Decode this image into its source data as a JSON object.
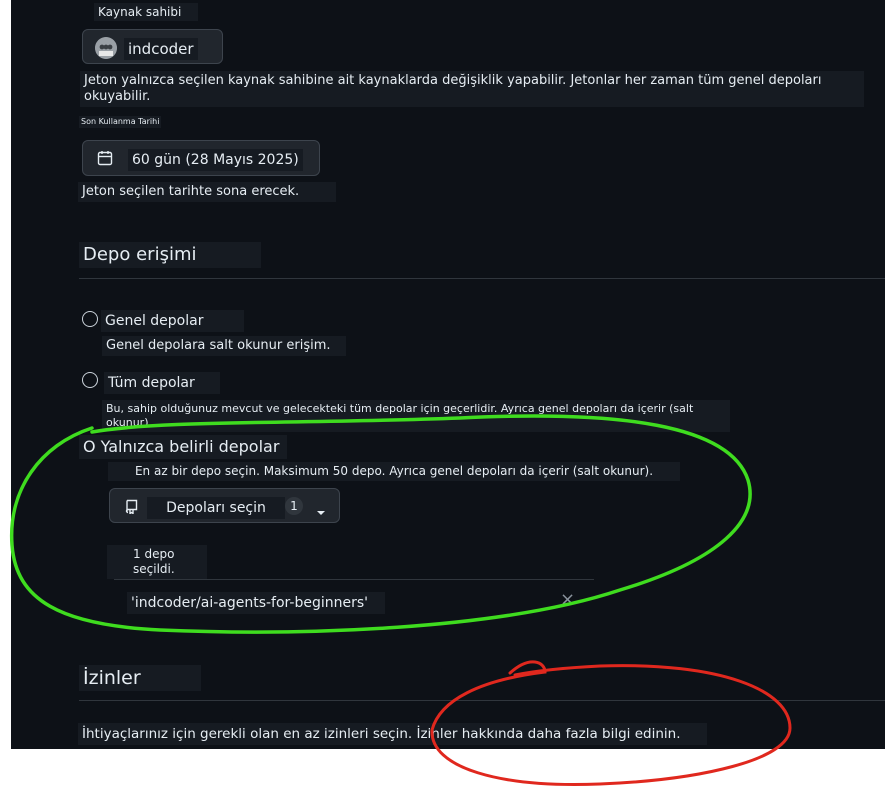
{
  "owner": {
    "label": "Kaynak sahibi",
    "selected": "indcoder",
    "help": "Jeton yalnızca seçilen kaynak sahibine ait kaynaklarda değişiklik yapabilir. Jetonlar her zaman tüm genel depoları okuyabilir."
  },
  "expiration": {
    "label": "Son Kullanma Tarihi",
    "selected": "60 gün (28 Mayıs 2025)",
    "help": "Jeton seçilen tarihte sona erecek."
  },
  "repo_access": {
    "heading": "Depo erişimi",
    "options": [
      {
        "label": "Genel depolar",
        "description": "Genel depolara salt okunur erişim."
      },
      {
        "label": "Tüm depolar",
        "description": "Bu, sahip olduğunuz mevcut ve gelecekteki tüm depolar için geçerlidir. Ayrıca genel depoları da içerir (salt okunur)."
      },
      {
        "label": "O Yalnızca belirli depolar",
        "description": "En az bir depo seçin. Maksimum 50 depo. Ayrıca genel depoları da içerir (salt okunur)."
      }
    ],
    "select_button": "Depoları seçin",
    "select_count": "1",
    "selected_summary": "1 depo seçildi.",
    "selected_repo": "'indcoder/ai-agents-for-beginners'",
    "remove_symbol": "×"
  },
  "permissions": {
    "heading": "İzinler",
    "text": "İhtiyaçlarınız için gerekli olan en az izinleri seçin. İzinler hakkında daha fazla bilgi edinin."
  },
  "annotations": {
    "green": "#3fdc1f",
    "red": "#e0281e"
  }
}
